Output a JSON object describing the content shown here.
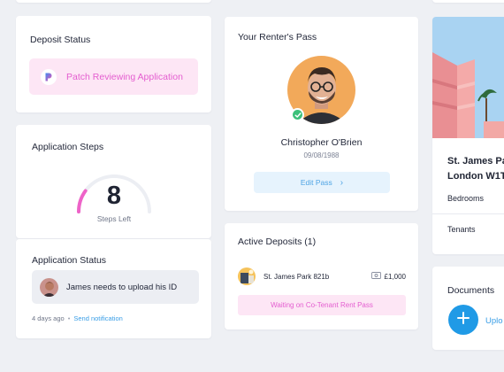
{
  "deposit_status": {
    "title": "Deposit Status",
    "logo_icon": "p-logo-icon",
    "status_text": "Patch Reviewing Application"
  },
  "application_steps": {
    "title": "Application Steps",
    "steps_left_number": "8",
    "steps_left_label": "Steps Left",
    "progress_fraction": 0.2
  },
  "application_status": {
    "title": "Application Status",
    "message": "James needs to upload his ID",
    "time_ago": "4 days ago",
    "separator": "•",
    "action_link": "Send notification"
  },
  "renters_pass": {
    "title": "Your Renter's Pass",
    "name": "Christopher O'Brien",
    "dob": "09/08/1988",
    "edit_button": "Edit Pass",
    "edit_chevron": "›"
  },
  "active_deposits": {
    "title": "Active Deposits (1)",
    "deposits": [
      {
        "property": "St. James Park 821b",
        "amount": "£1,000",
        "status": "Waiting on Co-Tenant Rent Pass"
      }
    ]
  },
  "property": {
    "title_line1": "St. James Pa",
    "title_line2": "London W1T",
    "rows": [
      "Bedrooms",
      "Tenants"
    ]
  },
  "documents": {
    "title": "Documents",
    "upload_label": "Uplo",
    "upload_icon": "plus-icon"
  },
  "colors": {
    "background": "#eef0f4",
    "pink_accent": "#e45ed0",
    "pink_bg": "#fde6f5",
    "blue_accent": "#209ae6",
    "gauge_pink": "#ee63c8",
    "gauge_track": "#eceef3"
  }
}
